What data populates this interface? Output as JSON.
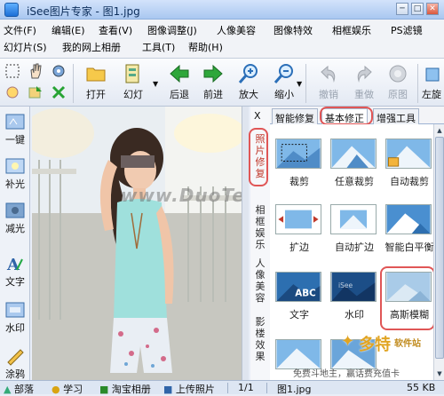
{
  "window": {
    "title": "iSee图片专家 - 图1.jpg",
    "min": "─",
    "max": "□",
    "close": "✕"
  },
  "menu": {
    "row1": [
      "文件(F)",
      "编辑(E)",
      "查看(V)",
      "图像调整(J)",
      "人像美容",
      "图像特效",
      "相框娱乐",
      "PS滤镜"
    ],
    "row2": [
      "幻灯片(S)",
      "我的网上相册",
      "工具(T)",
      "帮助(H)"
    ]
  },
  "toolbar": {
    "open": "打开",
    "slideshow": "幻灯",
    "back": "后退",
    "forward": "前进",
    "zoom_in": "放大",
    "zoom_out": "缩小",
    "undo": "撤销",
    "redo": "重做",
    "original": "原图",
    "rotate_left": "左旋"
  },
  "left_tools": [
    "一键",
    "补光",
    "减光",
    "文字",
    "水印",
    "涂鸦"
  ],
  "close_panel": "X",
  "side_tabs": [
    "照片修复",
    "相框娱乐",
    "人像美容",
    "影楼效果"
  ],
  "tabs": [
    "智能修复",
    "基本修正",
    "增强工具"
  ],
  "gallery": [
    "裁剪",
    "任意裁剪",
    "自动裁剪",
    "扩边",
    "自动扩边",
    "智能白平衡",
    "文字",
    "水印",
    "高斯模糊"
  ],
  "gallery_thumb_texts": {
    "text": "ABC",
    "watermark": "iSee"
  },
  "status": {
    "items": [
      "部落",
      "学习",
      "淘宝相册",
      "上传照片"
    ],
    "page": "1/1",
    "file": "图1.jpg",
    "size": "55 KB"
  },
  "watermark": "www.DuoTe.com",
  "promo": "免费斗地主，赢话费充值卡",
  "badge": {
    "brand": "多特",
    "sub": "软件站"
  },
  "colors": {
    "accent_ring": "#e05656",
    "title_bar": "#a9c7f0",
    "badge": "#e1a422"
  }
}
